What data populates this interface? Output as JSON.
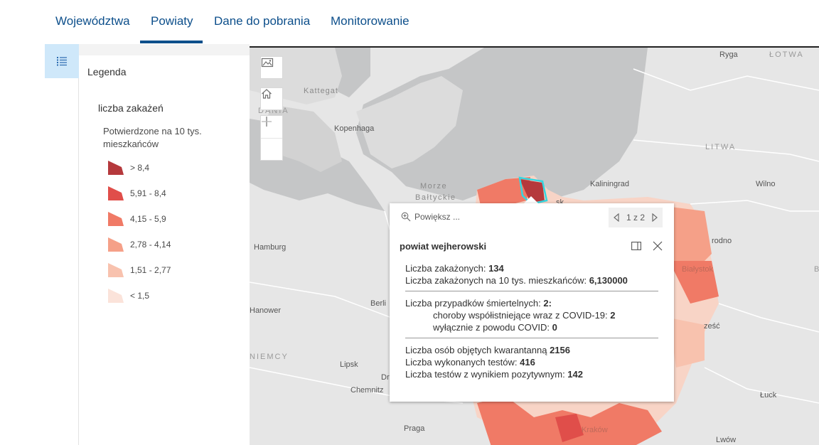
{
  "tabs": [
    {
      "label": "Województwa",
      "active": false
    },
    {
      "label": "Powiaty",
      "active": true
    },
    {
      "label": "Dane do pobrania",
      "active": false
    },
    {
      "label": "Monitorowanie",
      "active": false
    }
  ],
  "sidebar": {
    "legend_icon": "legend-list-icon"
  },
  "legend": {
    "title": "Legenda",
    "layer": "liczba zakażeń",
    "field": "Potwierdzone na 10 tys. mieszkańców",
    "classes": [
      {
        "label": "> 8,4",
        "color": "#b5393c"
      },
      {
        "label": "5,91 - 8,4",
        "color": "#e04e4a"
      },
      {
        "label": "4,15 - 5,9",
        "color": "#f07a66"
      },
      {
        "label": "2,78 - 4,14",
        "color": "#f5a088"
      },
      {
        "label": "1,51 - 2,77",
        "color": "#f8c2ae"
      },
      {
        "label": "< 1,5",
        "color": "#fbe3da"
      }
    ]
  },
  "map": {
    "tools": [
      "basemap-gallery-icon",
      "home-icon",
      "zoom-in-icon",
      "zoom-out-icon"
    ],
    "labels": {
      "ryga": "Ryga",
      "lotwa": "ŁOTWA",
      "kattegat": "Kattegat",
      "dania": "DANIA",
      "kopenhaga": "Kopenhaga",
      "litwa": "LITWA",
      "morze": "Morze",
      "baltyckie": "Bałtyckie",
      "kaliningrad": "Kaliningrad",
      "wilno": "Wilno",
      "gdansk": "sk",
      "hamburg": "Hamburg",
      "grodno": "rodno",
      "berlin": "Berli",
      "hanower": "Hanower",
      "niemcy": "NIEMCY",
      "brzesc": "ześć",
      "lipsk": "Lipsk",
      "dr": "Dr",
      "chemnitz": "Chemnitz",
      "luck": "Łuck",
      "praga": "Praga",
      "lwow": "Lwów",
      "bialystok": "Białystok",
      "krakow": "Kraków",
      "edge_b": "B"
    }
  },
  "popup": {
    "zoom_label": "Powiększ ...",
    "pager": "1 z 2",
    "title": "powiat wejherowski",
    "l1_label": "Liczba zakażonych: ",
    "l1_value": "134",
    "l2_label": "Liczba zakażonych na 10 tys. mieszkańców: ",
    "l2_value": "6,130000",
    "l3_label": "Liczba przypadków śmiertelnych: ",
    "l3_value": "2:",
    "l4_label": "choroby współistniejące wraz z COVID-19: ",
    "l4_value": "2",
    "l5_label": "wyłącznie z powodu COVID: ",
    "l5_value": "0",
    "l6_label": "Liczba osób objętych kwarantanną ",
    "l6_value": "2156",
    "l7_label": "Liczba wykonanych testów: ",
    "l7_value": "416",
    "l8_label": "Liczba testów z wynikiem pozytywnym: ",
    "l8_value": "142"
  }
}
